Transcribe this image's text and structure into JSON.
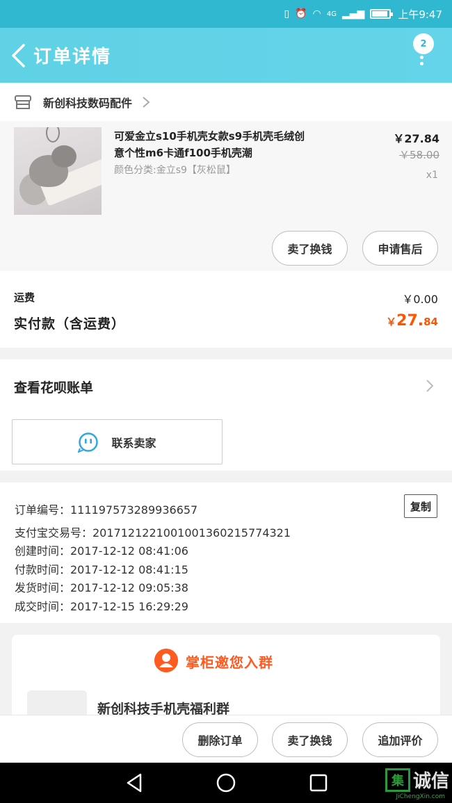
{
  "status_bar": {
    "network": "4G",
    "time": "上午9:47",
    "battery_level": 0.85
  },
  "header": {
    "title": "订单详情",
    "badge_count": "2"
  },
  "shop": {
    "name": "新创科技数码配件"
  },
  "product": {
    "title_line1": "可爱金立s10手机壳女款s9手机壳毛绒创",
    "title_line2": "意个性m6卡通f100手机壳潮",
    "sku": "颜色分类:金立s9【灰松鼠】",
    "price": "￥27.84",
    "original_price": "￥58.00",
    "quantity": "x1",
    "actions": [
      "卖了换钱",
      "申请售后"
    ]
  },
  "amounts": {
    "shipping_label": "运费",
    "shipping_value": "￥0.00",
    "paid_label": "实付款（含运费）",
    "paid_currency": "￥",
    "paid_int": "27.",
    "paid_dec": "84"
  },
  "huabei": {
    "label": "查看花呗账单"
  },
  "contact": {
    "label": "联系卖家"
  },
  "order_info": {
    "copy_label": "复制",
    "lines": [
      "订单编号：111197573289936657",
      "支付宝交易号：2017121221001001360215774321",
      "创建时间：2017-12-12 08:41:06",
      "付款时间：2017-12-12 08:41:15",
      "发货时间：2017-12-12 09:05:38",
      "成交时间：2017-12-15 16:29:29"
    ]
  },
  "group": {
    "title": "掌柜邀您入群",
    "name": "新创科技手机壳福利群"
  },
  "bottom_actions": [
    "删除订单",
    "卖了换钱",
    "追加评价"
  ],
  "watermark": {
    "text": "诚信",
    "box": "集",
    "sub": "JiChengXin.com"
  },
  "colors": {
    "accent": "#5fd2e6",
    "price_orange": "#ff5500",
    "group_orange": "#ff5a1f"
  }
}
